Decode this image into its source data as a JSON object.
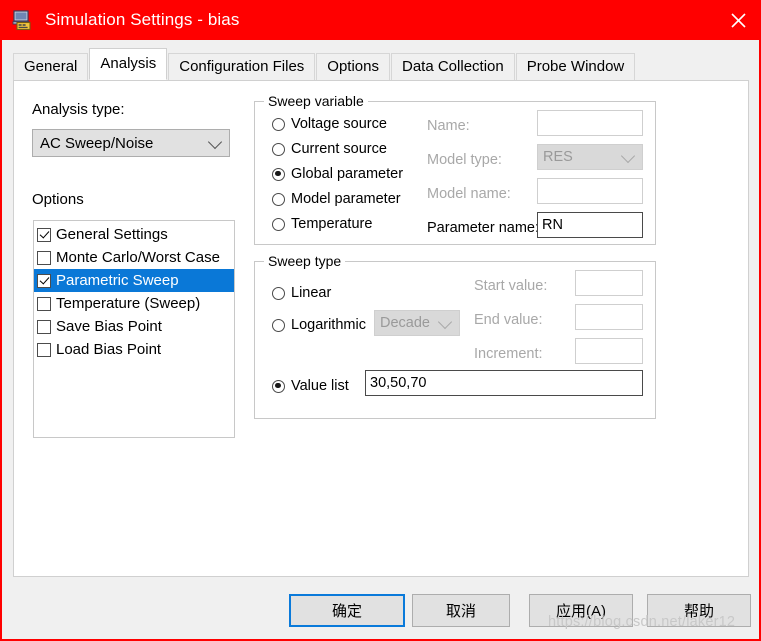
{
  "window": {
    "title": "Simulation Settings - bias",
    "icon": "simulation-settings-icon",
    "close_label": "✕",
    "titlebar_color": "#ff0000"
  },
  "tabs": [
    {
      "label": "General",
      "active": false
    },
    {
      "label": "Analysis",
      "active": true
    },
    {
      "label": "Configuration Files",
      "active": false
    },
    {
      "label": "Options",
      "active": false
    },
    {
      "label": "Data Collection",
      "active": false
    },
    {
      "label": "Probe Window",
      "active": false
    }
  ],
  "analysis": {
    "type_label": "Analysis type:",
    "type_value": "AC Sweep/Noise",
    "options_label": "Options",
    "options": [
      {
        "label": "General Settings",
        "checked": true,
        "selected": false
      },
      {
        "label": "Monte Carlo/Worst Case",
        "checked": false,
        "selected": false
      },
      {
        "label": "Parametric Sweep",
        "checked": true,
        "selected": true
      },
      {
        "label": "Temperature (Sweep)",
        "checked": false,
        "selected": false
      },
      {
        "label": "Save Bias Point",
        "checked": false,
        "selected": false
      },
      {
        "label": "Load Bias Point",
        "checked": false,
        "selected": false
      }
    ]
  },
  "sweep_variable": {
    "title": "Sweep variable",
    "radios": [
      {
        "label": "Voltage source",
        "selected": false
      },
      {
        "label": "Current source",
        "selected": false
      },
      {
        "label": "Global parameter",
        "selected": true
      },
      {
        "label": "Model parameter",
        "selected": false
      },
      {
        "label": "Temperature",
        "selected": false
      }
    ],
    "name_label": "Name:",
    "name_value": "",
    "model_type_label": "Model type:",
    "model_type_value": "RES",
    "model_name_label": "Model name:",
    "model_name_value": "",
    "parameter_name_label": "Parameter name:",
    "parameter_name_value": "RN"
  },
  "sweep_type": {
    "title": "Sweep type",
    "radios": [
      {
        "label": "Linear",
        "selected": false
      },
      {
        "label": "Logarithmic",
        "selected": false
      },
      {
        "label": "Value list",
        "selected": true
      }
    ],
    "log_scale_value": "Decade",
    "start_label": "Start value:",
    "start_value": "",
    "end_label": "End value:",
    "end_value": "",
    "increment_label": "Increment:",
    "increment_value": "",
    "value_list": "30,50,70"
  },
  "footer": {
    "ok": "确定",
    "cancel": "取消",
    "apply": "应用(A)",
    "help": "帮助"
  },
  "watermark": "https://blog.csdn.net/laker12"
}
